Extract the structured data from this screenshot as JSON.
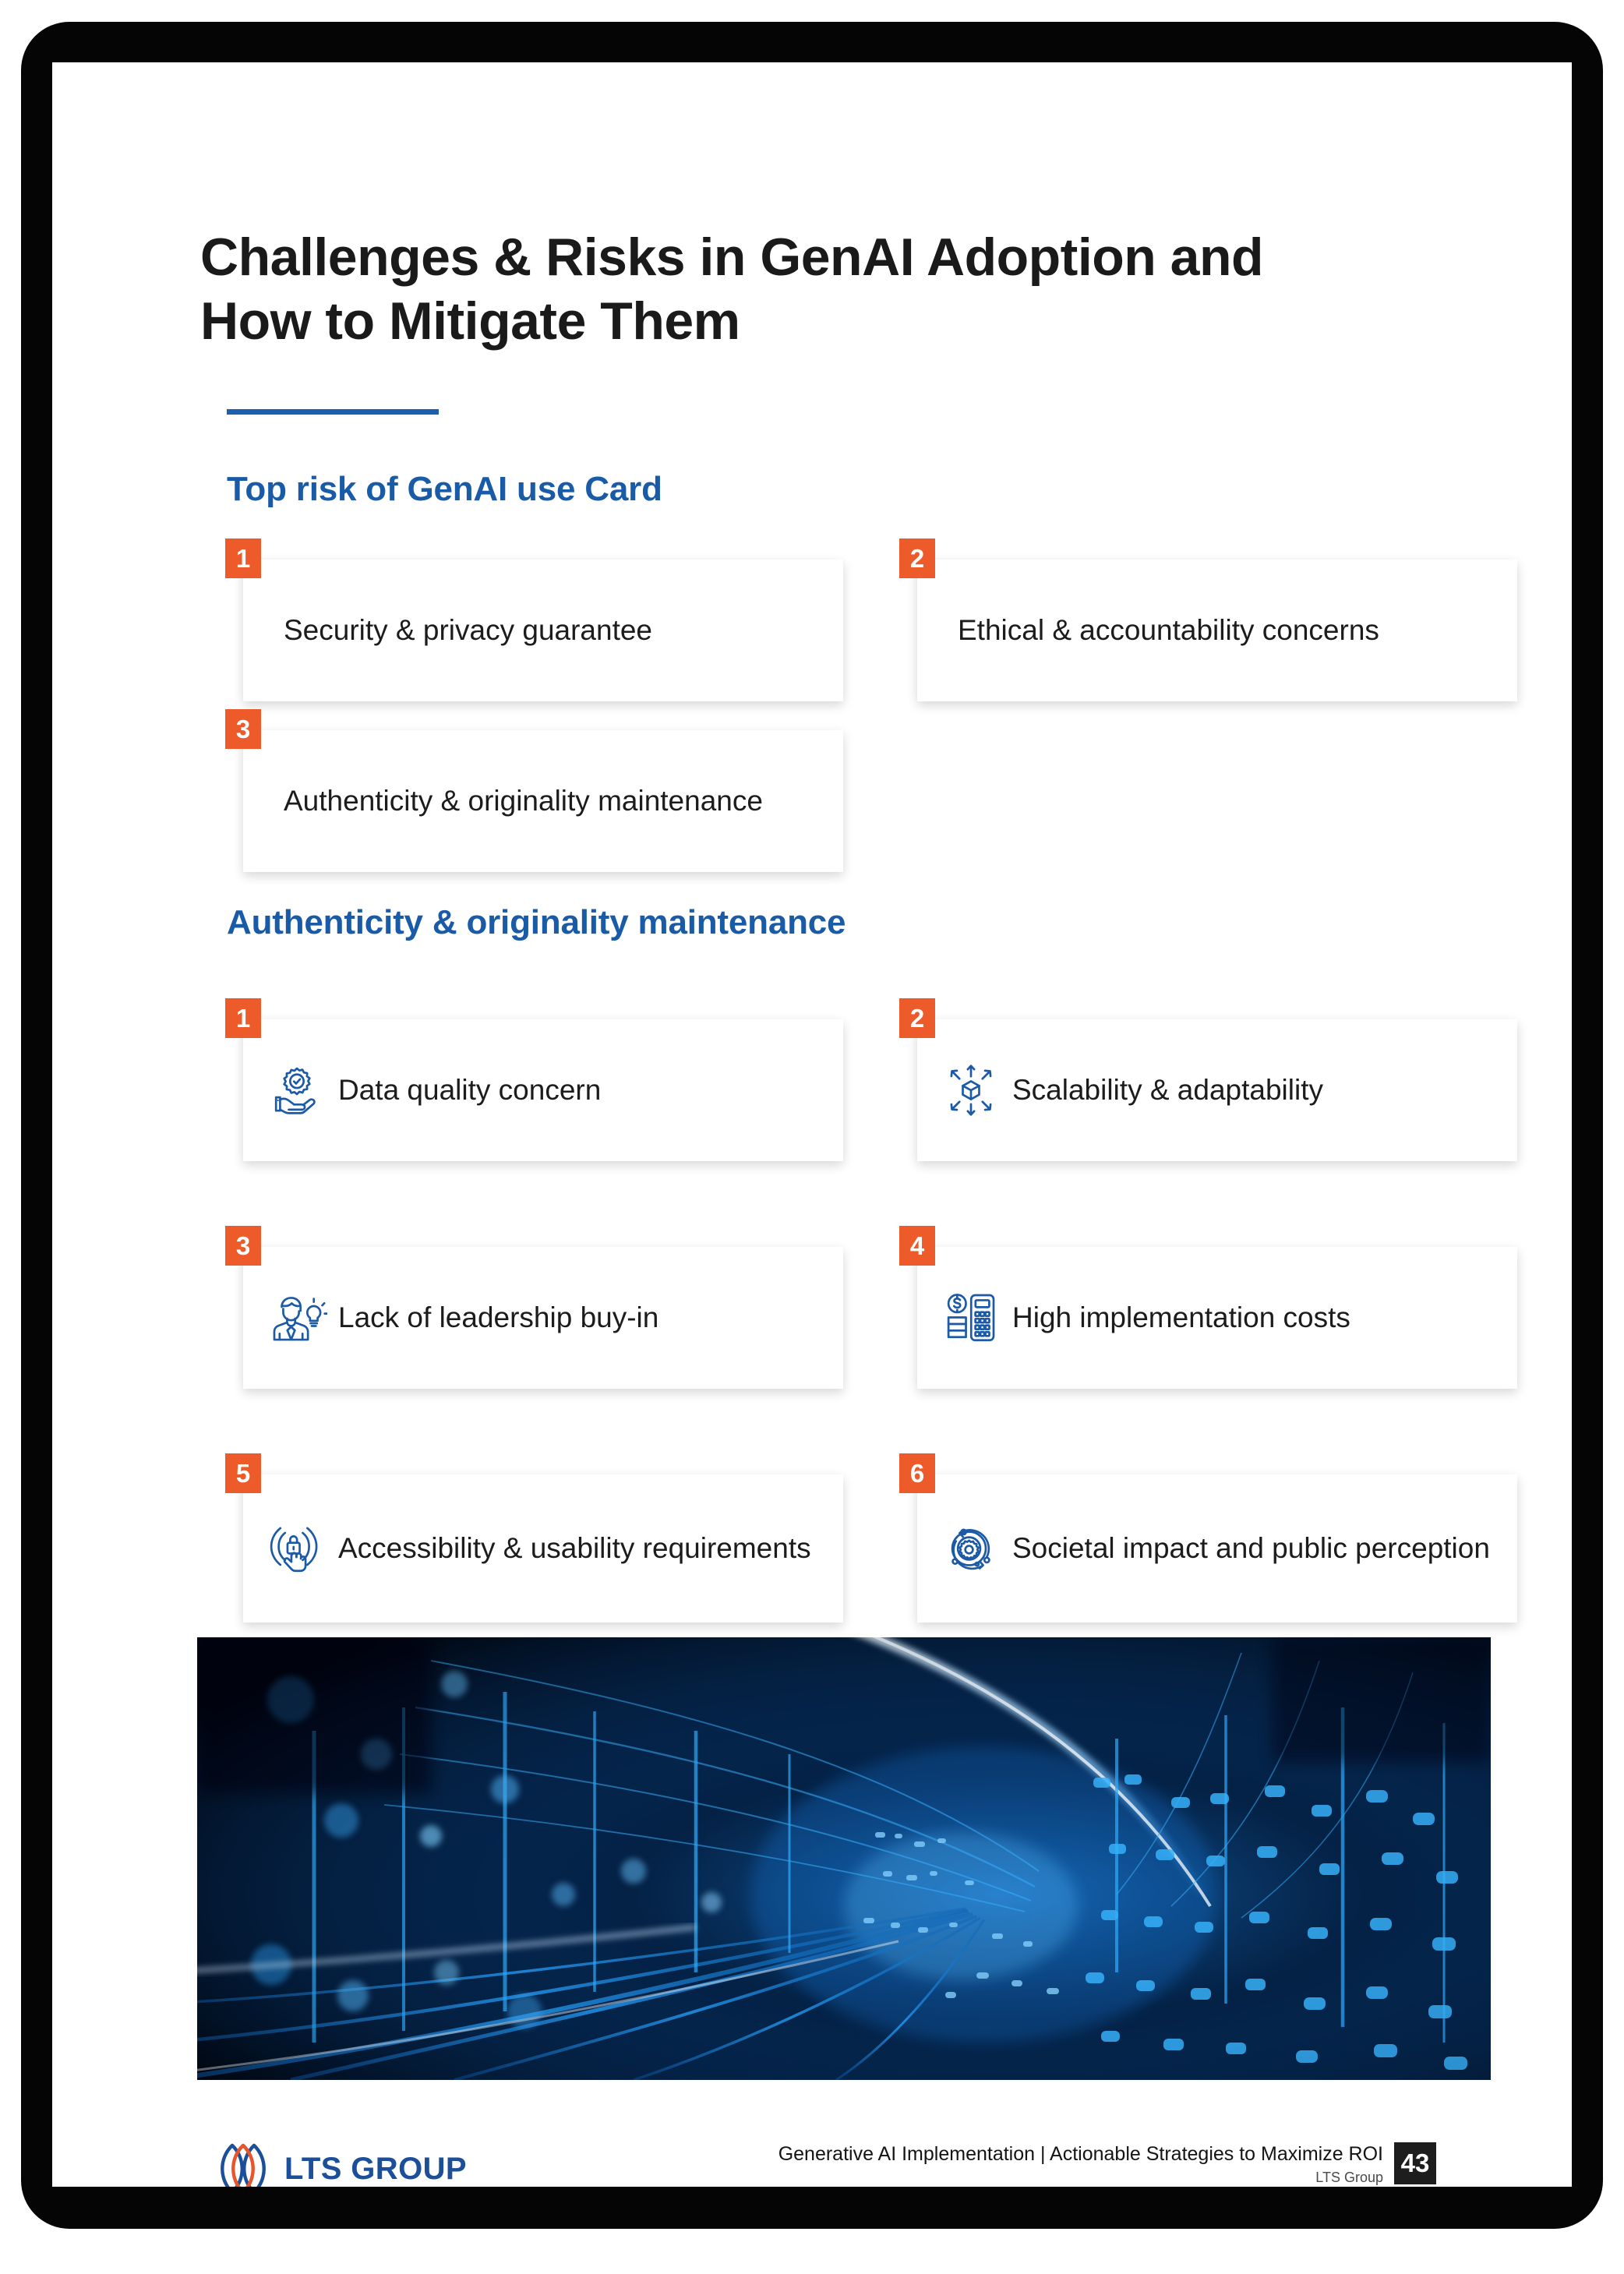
{
  "document": {
    "title_line_1": "Challenges & Risks in GenAI Adoption and",
    "title_line_2": "How to Mitigate Them",
    "accent_blue": "#1a5ba8",
    "accent_orange": "#ec5b29",
    "underline_color": "#1b5fae"
  },
  "sections": [
    {
      "heading": "Top risk of GenAI use Card",
      "cards": [
        {
          "number": "1",
          "label": "Security & privacy guarantee",
          "icon": "none"
        },
        {
          "number": "2",
          "label": "Ethical & accountability concerns",
          "icon": "none"
        },
        {
          "number": "3",
          "label": "Authenticity & originality maintenance",
          "icon": "none"
        }
      ]
    },
    {
      "heading": "Authenticity & originality maintenance",
      "cards": [
        {
          "number": "1",
          "label": "Data quality concern",
          "icon": "hand-holding-gear-check-icon"
        },
        {
          "number": "2",
          "label": "Scalability & adaptability",
          "icon": "cube-expand-arrows-icon"
        },
        {
          "number": "3",
          "label": "Lack of leadership buy-in",
          "icon": "businessman-lightbulb-icon"
        },
        {
          "number": "4",
          "label": "High implementation costs",
          "icon": "coins-calculator-icon"
        },
        {
          "number": "5",
          "label": "Accessibility & usability requirements",
          "icon": "tap-touch-ripple-icon"
        },
        {
          "number": "6",
          "label": "Societal impact and public perception",
          "icon": "gear-orbit-icon"
        }
      ]
    }
  ],
  "hero": {
    "alt": "abstract blue digital data stream tunnel"
  },
  "footer": {
    "logo_text": "LTS GROUP",
    "deck_title": "Generative AI Implementation | Actionable Strategies to Maximize ROI",
    "company": "LTS Group",
    "page_number": "43"
  }
}
